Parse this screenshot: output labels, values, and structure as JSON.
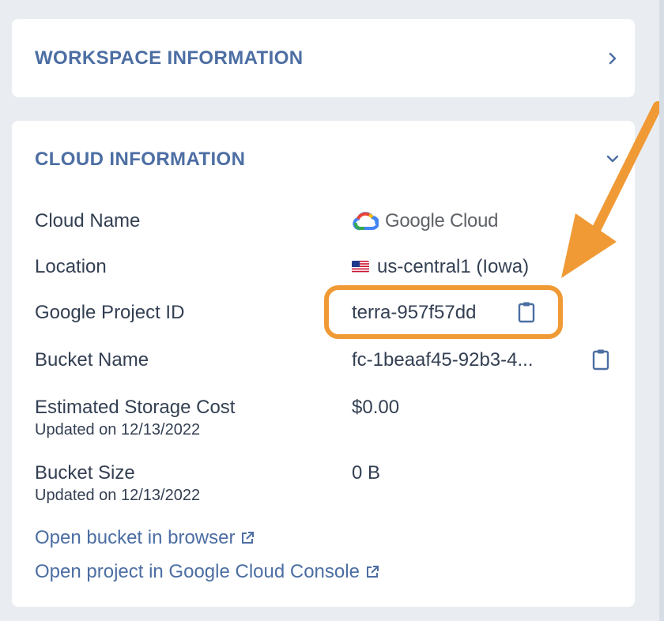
{
  "workspace_section": {
    "title": "WORKSPACE INFORMATION",
    "toggle_icon": "chevron-right-icon"
  },
  "cloud_section": {
    "title": "CLOUD INFORMATION",
    "toggle_icon": "chevron-down-icon",
    "cloud_name": {
      "label": "Cloud Name",
      "value_logo": "Google Cloud",
      "logo_word_1": "Google",
      "logo_word_2": "Cloud"
    },
    "location": {
      "label": "Location",
      "flag": "us-flag",
      "value": "us-central1 (Iowa)"
    },
    "project_id": {
      "label": "Google Project ID",
      "value": "terra-957f57dd",
      "copy_icon": "clipboard-icon"
    },
    "bucket_name": {
      "label": "Bucket Name",
      "value": "fc-1beaaf45-92b3-4...",
      "copy_icon": "clipboard-icon"
    },
    "storage_cost": {
      "label": "Estimated Storage Cost",
      "updated": "Updated on 12/13/2022",
      "value": "$0.00"
    },
    "bucket_size": {
      "label": "Bucket Size",
      "updated": "Updated on 12/13/2022",
      "value": "0 B"
    },
    "links": {
      "open_bucket": "Open bucket in browser",
      "open_project": "Open project in Google Cloud Console"
    }
  },
  "colors": {
    "accent": "#4c6ea3",
    "text": "#333f52",
    "annotation": "#f09a36",
    "background": "#e9edf2"
  }
}
